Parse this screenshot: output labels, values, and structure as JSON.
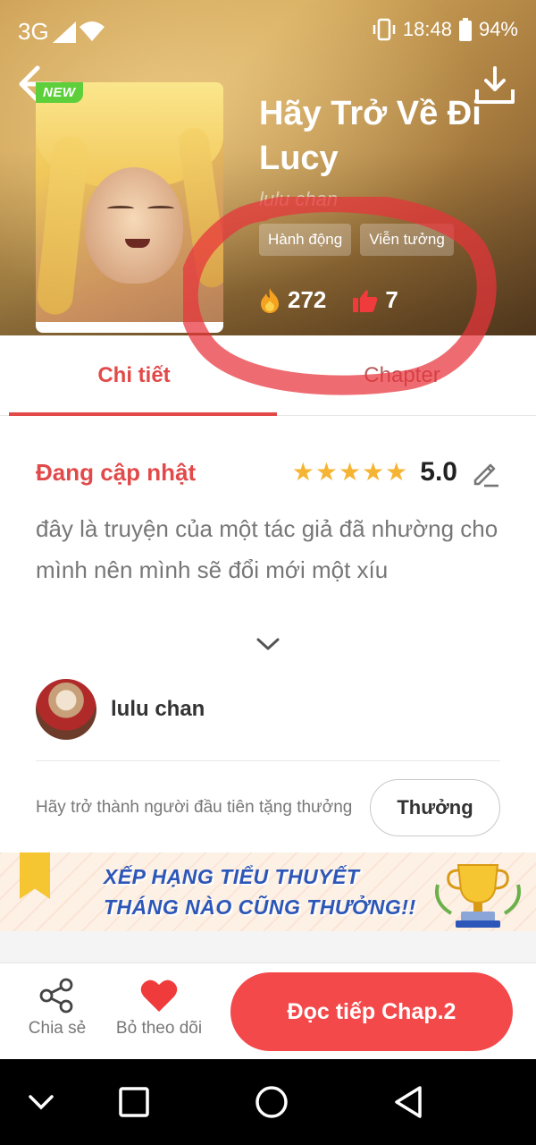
{
  "status_bar": {
    "network": "3G",
    "time": "18:48",
    "battery": "94%"
  },
  "header": {
    "badge": "NEW",
    "title": "Hãy Trở Về Đi Lucy",
    "author": "lulu chan",
    "tags": [
      "Hành động",
      "Viễn tưởng"
    ],
    "views": "272",
    "likes": "7"
  },
  "tabs": [
    {
      "label": "Chi tiết",
      "active": true
    },
    {
      "label": "Chapter",
      "active": false
    }
  ],
  "detail": {
    "status": "Đang cập nhật",
    "rating_stars": 5,
    "rating_value": "5.0",
    "description": "đây là truyện của một tác giả đã nhường cho mình nên mình sẽ đổi mới một xíu"
  },
  "author_section": {
    "name": "lulu chan"
  },
  "reward": {
    "prompt": "Hãy trở thành người đầu tiên tặng thưởng",
    "button": "Thưởng"
  },
  "banner": {
    "line1": "XẾP HẠNG TIỂU THUYẾT",
    "line2": "THÁNG NÀO CŨNG THƯỞNG!!"
  },
  "actions": {
    "share": "Chia sẻ",
    "unfollow": "Bỏ theo dõi",
    "read": "Đọc tiếp Chap.2"
  },
  "colors": {
    "accent": "#f4494b",
    "tab_active": "#e24a4a",
    "star": "#f6b434",
    "badge_new": "#5ccf3a",
    "annotation": "#e8333a"
  },
  "icons": {
    "back": "arrow-left-icon",
    "download": "download-icon",
    "views": "fire-icon",
    "likes": "thumbs-up-icon",
    "edit": "pencil-icon",
    "expand": "chevron-down-icon",
    "share": "share-icon",
    "follow": "heart-icon"
  }
}
